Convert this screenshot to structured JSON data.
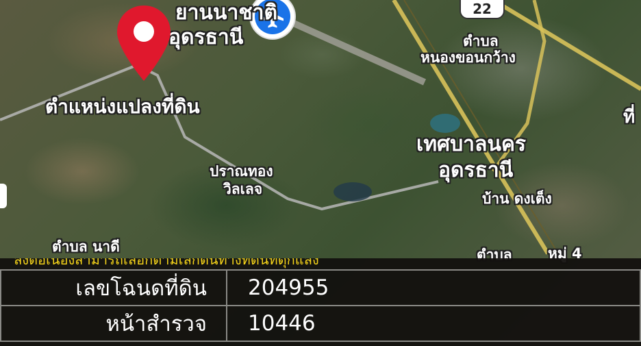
{
  "map": {
    "labels": {
      "airport_name": "ท่าอากาศยานนานาชาติ อุดรธานี",
      "airport_line1": "ยานนาชาติ",
      "airport_line2": "อุดรธานี",
      "plot_location": "ตำแหน่งแปลงที่ดิน",
      "subdistrict_top": "ตำบล",
      "subdistrict_top_name": "หนองขอนกว้าง",
      "municipality_line1": "เทศบาลนคร",
      "municipality_line2": "อุดรธานี",
      "village_line1": "ปราณทอง",
      "village_line2": "วิลเลจ",
      "ban_label": "บ้าน ดงเต็ง",
      "bottom_left": "ตำบล นาดี",
      "bottom_right_a": "ตำบล",
      "bottom_right_b": "หมู่ 4",
      "right_edge": "ที่"
    },
    "highway_shield": "22",
    "pin_color": "#e0182d",
    "airport_icon": "airplane-icon",
    "road_color": "#d8c25a"
  },
  "info_panel": {
    "note": "ลงต่อเนื่องสามารถเลือกตามเลกต้นทางที่ดินที่ดุกแลง",
    "rows": [
      {
        "label": "เลขโฉนดที่ดิน",
        "value": "204955"
      },
      {
        "label": "หน้าสำรวจ",
        "value": "10446"
      }
    ]
  }
}
